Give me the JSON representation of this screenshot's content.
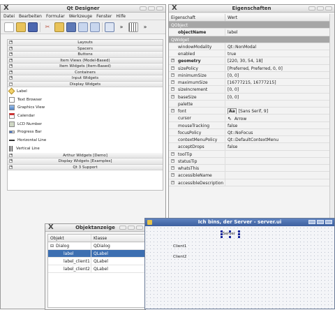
{
  "designer": {
    "title": "Qt Designer",
    "menu": [
      "Datei",
      "Bearbeiten",
      "Formular",
      "Werkzeuge",
      "Fenster",
      "Hilfe"
    ],
    "categories_top": [
      {
        "label": "Layouts",
        "expanded": false
      },
      {
        "label": "Spacers",
        "expanded": false
      },
      {
        "label": "Buttons",
        "expanded": false
      },
      {
        "label": "Item Views (Model-Based)",
        "expanded": false
      },
      {
        "label": "Item Widgets (Item-Based)",
        "expanded": false
      },
      {
        "label": "Containers",
        "expanded": false
      },
      {
        "label": "Input Widgets",
        "expanded": false
      },
      {
        "label": "Display Widgets",
        "expanded": true
      }
    ],
    "display_widgets": [
      {
        "label": "Label",
        "icon": "label-icon"
      },
      {
        "label": "Text Browser",
        "icon": "text-browser-icon"
      },
      {
        "label": "Graphics View",
        "icon": "graphics-view-icon"
      },
      {
        "label": "Calendar",
        "icon": "calendar-icon"
      },
      {
        "label": "LCD Number",
        "icon": "lcd-number-icon"
      },
      {
        "label": "Progress Bar",
        "icon": "progress-bar-icon"
      },
      {
        "label": "Horizontal Line",
        "icon": "horizontal-line-icon"
      },
      {
        "label": "Vertical Line",
        "icon": "vertical-line-icon"
      }
    ],
    "categories_bottom": [
      {
        "label": "Arthur Widgets [Demo]"
      },
      {
        "label": "Display Widgets [Examples]"
      },
      {
        "label": "Qt 3 Support"
      }
    ]
  },
  "properties": {
    "title": "Eigenschaften",
    "col_property": "Eigenschaft",
    "col_value": "Wert",
    "rows": [
      {
        "name": "QObject",
        "value": "",
        "type": "section"
      },
      {
        "name": "objectName",
        "value": "label",
        "bold": true
      },
      {
        "name": "QWidget",
        "value": "",
        "type": "section"
      },
      {
        "name": "windowModality",
        "value": "Qt::NonModal"
      },
      {
        "name": "enabled",
        "value": "true"
      },
      {
        "name": "geometry",
        "value": "[220, 30, 54, 18]",
        "expand": true,
        "bold": true
      },
      {
        "name": "sizePolicy",
        "value": "[Preferred, Preferred, 0, 0]",
        "expand": true
      },
      {
        "name": "minimumSize",
        "value": "[0, 0]",
        "expand": true
      },
      {
        "name": "maximumSize",
        "value": "[16777215, 16777215]",
        "expand": true
      },
      {
        "name": "sizeIncrement",
        "value": "[0, 0]",
        "expand": true
      },
      {
        "name": "baseSize",
        "value": "[0, 0]",
        "expand": true
      },
      {
        "name": "palette",
        "value": ""
      },
      {
        "name": "font",
        "value": "[Sans Serif, 9]",
        "expand": true,
        "font_sample": "Aa"
      },
      {
        "name": "cursor",
        "value": "Arrow",
        "cursor_icon": true
      },
      {
        "name": "mouseTracking",
        "value": "false"
      },
      {
        "name": "focusPolicy",
        "value": "Qt::NoFocus"
      },
      {
        "name": "contextMenuPolicy",
        "value": "Qt::DefaultContextMenu"
      },
      {
        "name": "acceptDrops",
        "value": "false"
      },
      {
        "name": "toolTip",
        "value": "",
        "expand": true
      },
      {
        "name": "statusTip",
        "value": "",
        "expand": true
      },
      {
        "name": "whatsThis",
        "value": "",
        "expand": true
      },
      {
        "name": "accessibleName",
        "value": "",
        "expand": true
      },
      {
        "name": "accessibleDescription",
        "value": "",
        "expand": true
      }
    ]
  },
  "objects": {
    "title": "Objektanzeige",
    "col_object": "Objekt",
    "col_class": "Klasse",
    "rows": [
      {
        "object": "Dialog",
        "class": "QDialog",
        "indent": false,
        "expand": true
      },
      {
        "object": "label",
        "class": "QLabel",
        "indent": true,
        "selected": true
      },
      {
        "object": "label_client1",
        "class": "QLabel",
        "indent": true
      },
      {
        "object": "label_client2",
        "class": "QLabel",
        "indent": true
      }
    ]
  },
  "form": {
    "title": "Ich bins, der Server - server.ui",
    "server_label": "Server",
    "client1": "Client1",
    "client2": "Client2"
  }
}
